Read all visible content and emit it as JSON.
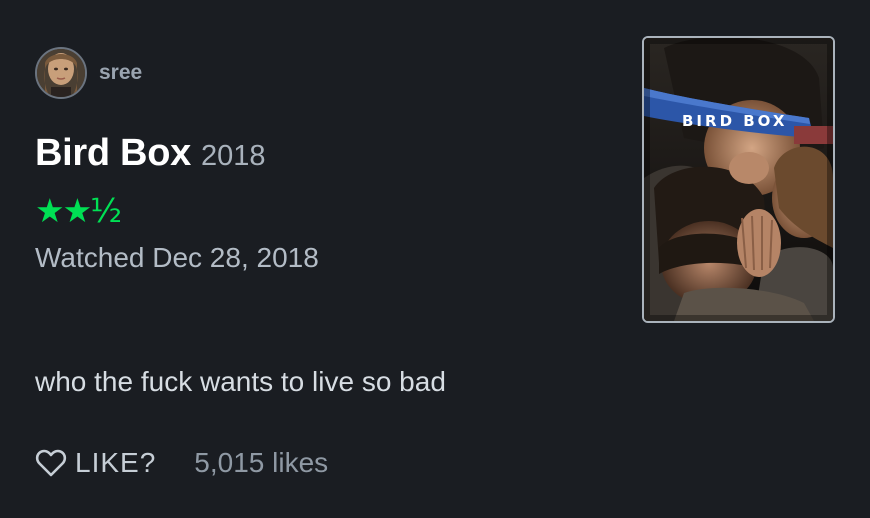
{
  "review": {
    "username": "sree",
    "film_title": "Bird Box",
    "film_year": "2018",
    "rating_stars": "★★½",
    "rating_value": 2.5,
    "watched": "Watched Dec 28, 2018",
    "text": "who the fuck wants to live so bad",
    "like_label": "LIKE?",
    "likes_count": "5,015 likes"
  },
  "poster": {
    "title_text": "BIRD BOX"
  },
  "icons": {
    "heart": "heart-outline-icon",
    "avatar": "user-avatar"
  },
  "colors": {
    "background": "#1a1d22",
    "rating_green": "#00e054",
    "username": "#9aa4b0",
    "poster_border": "#aab3bc"
  }
}
